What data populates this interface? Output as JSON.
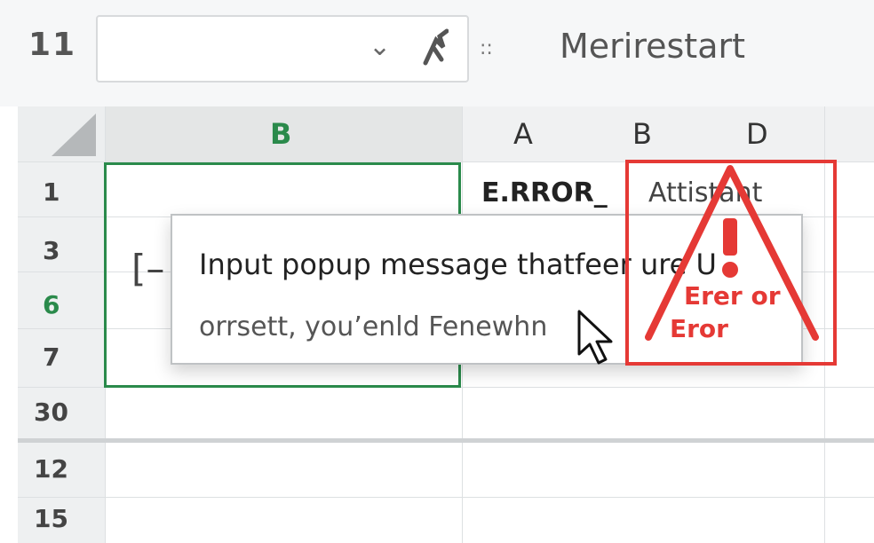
{
  "formula_bar": {
    "name_box_label": "11",
    "formula_text": "Merirestart",
    "separator": "::",
    "dropdown_icon": "chevron-down-icon",
    "function_icon": "fx-icon"
  },
  "columns": [
    "B",
    "A",
    "B",
    "D"
  ],
  "rows": [
    "1",
    "3",
    "6",
    "7",
    "30",
    "12",
    "15"
  ],
  "cells": {
    "a1": "E.RROR_",
    "b1": "Attistant"
  },
  "cell_bracket": "[–",
  "popup": {
    "line1": "Input popup message thatfeer ure U",
    "line2": "orrsett, you’enld Fenewhn"
  },
  "warning": {
    "line1": "Erer or",
    "line2": "Eror",
    "icon": "warning-triangle-icon"
  },
  "colors": {
    "selection": "#2a8a4b",
    "error": "#e53935"
  }
}
